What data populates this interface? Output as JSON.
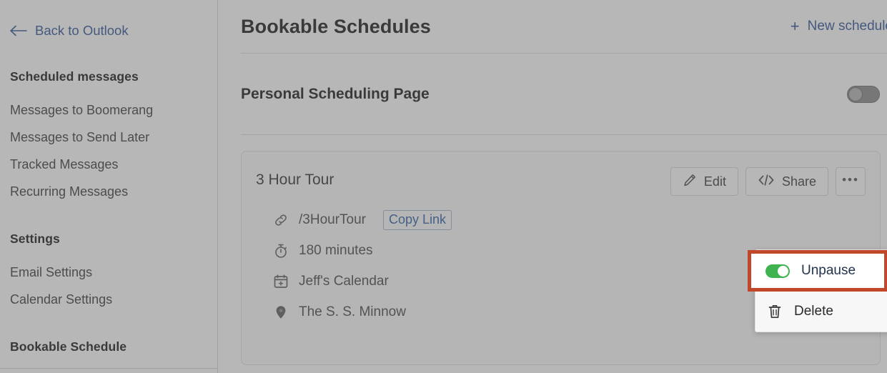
{
  "sidebar": {
    "back_link": {
      "label": "Back to Outlook",
      "icon": "arrow-left-icon"
    },
    "groups": [
      {
        "title": "Scheduled messages",
        "items": [
          {
            "label": "Messages to Boomerang"
          },
          {
            "label": "Messages to Send Later"
          },
          {
            "label": "Tracked Messages"
          },
          {
            "label": "Recurring Messages"
          }
        ]
      },
      {
        "title": "Settings",
        "items": [
          {
            "label": "Email Settings"
          },
          {
            "label": "Calendar Settings"
          }
        ]
      },
      {
        "title": "Bookable Schedule",
        "items": []
      }
    ]
  },
  "header": {
    "title": "Bookable Schedules",
    "new_schedule_label": "New schedule",
    "new_schedule_plus": "+"
  },
  "personal_scheduling": {
    "label": "Personal Scheduling Page",
    "toggle_state": "off"
  },
  "card": {
    "title": "3 Hour Tour",
    "actions": {
      "edit_label": "Edit",
      "share_label": "Share",
      "more_label": "•••"
    },
    "meta": [
      {
        "icon": "link-icon",
        "text": "/3HourTour",
        "button": "Copy Link"
      },
      {
        "icon": "stopwatch-icon",
        "text": "180 minutes"
      },
      {
        "icon": "calendar-add-icon",
        "text": "Jeff's Calendar"
      },
      {
        "icon": "location-pin-icon",
        "text": "The S. S. Minnow"
      }
    ]
  },
  "dropdown": {
    "items": [
      {
        "label": "Unpause",
        "icon": "toggle-on-icon",
        "highlighted": true
      },
      {
        "label": "Delete",
        "icon": "trash-icon",
        "highlighted": false
      }
    ]
  },
  "colors": {
    "accent_link": "#2f5496",
    "highlight_border": "#c2462a",
    "toggle_on_green": "#3eb34f",
    "overlay": "#606060"
  }
}
